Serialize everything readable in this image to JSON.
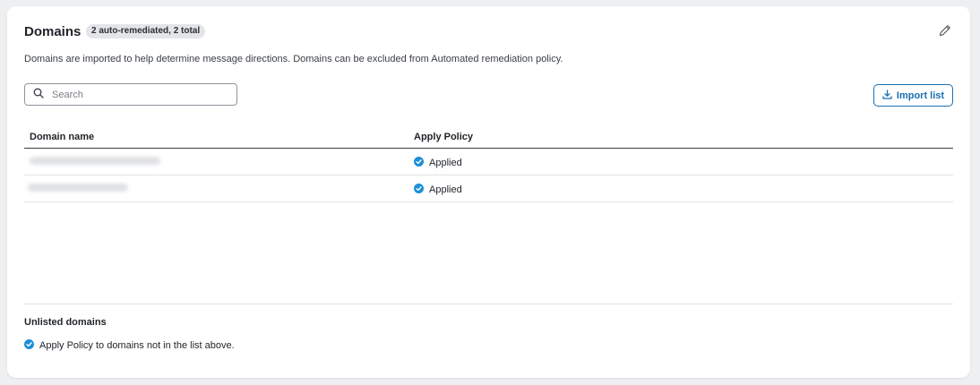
{
  "header": {
    "title": "Domains",
    "badge": "2 auto-remediated, 2 total",
    "edit_icon": "pencil-icon"
  },
  "description": "Domains are imported to help determine message directions. Domains can be excluded from Automated remediation policy.",
  "search": {
    "placeholder": "Search",
    "value": "",
    "icon": "search-icon"
  },
  "import_button": {
    "label": "Import list",
    "icon": "download-icon"
  },
  "table": {
    "columns": [
      "Domain name",
      "Apply Policy"
    ],
    "rows": [
      {
        "domain": "",
        "domain_redacted": true,
        "policy": "Applied",
        "policy_icon": "check-circle-icon"
      },
      {
        "domain": "",
        "domain_redacted": true,
        "policy": "Applied",
        "policy_icon": "check-circle-icon"
      }
    ]
  },
  "unlisted": {
    "title": "Unlisted domains",
    "text": "Apply Policy to domains not in the list above.",
    "icon": "check-circle-icon"
  },
  "colors": {
    "accent": "#1a6fb0",
    "check": "#1d8fd6",
    "badge_bg": "#e3e5e8"
  }
}
